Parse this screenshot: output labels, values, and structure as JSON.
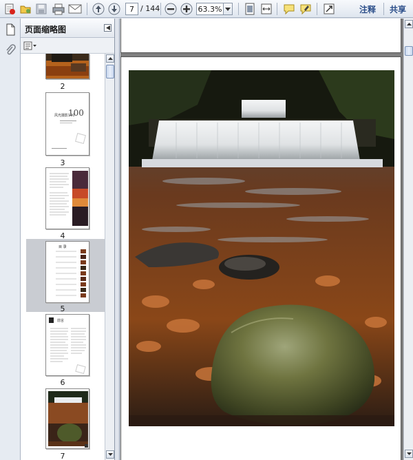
{
  "toolbar": {
    "current_page": "7",
    "total_pages": "/ 144",
    "zoom": "63.3%",
    "comment_label": "注释",
    "share_label": "共享",
    "icons": [
      "create-pdf-icon",
      "open-icon",
      "save-icon",
      "print-icon",
      "email-icon",
      "previous-page-icon",
      "next-page-icon",
      "zoom-out-icon",
      "zoom-in-icon",
      "fit-page-icon",
      "fit-width-icon",
      "comment-icon",
      "highlight-icon",
      "full-screen-icon"
    ]
  },
  "nav": {
    "icons": [
      "page-thumbnails-icon",
      "attachments-icon"
    ]
  },
  "thumbnails_panel": {
    "title": "页面缩略图",
    "pages": [
      {
        "label": "2",
        "kind": "photo-crop"
      },
      {
        "label": "3",
        "kind": "title-page",
        "title_text": "风光摄影100",
        "title_num": "100"
      },
      {
        "label": "4",
        "kind": "text-with-image"
      },
      {
        "label": "5",
        "kind": "contents",
        "selected": true,
        "heading": "目 录"
      },
      {
        "label": "6",
        "kind": "text-page",
        "heading": "前言"
      },
      {
        "label": "7",
        "kind": "waterfall-photo"
      }
    ]
  },
  "document": {
    "current_page": "7",
    "image_subject": "waterfall-with-mossy-rock"
  },
  "colors": {
    "toolbar_text": "#2c4f8a",
    "selection": "#c9ccd2",
    "doc_background": "#7f7f7f"
  }
}
